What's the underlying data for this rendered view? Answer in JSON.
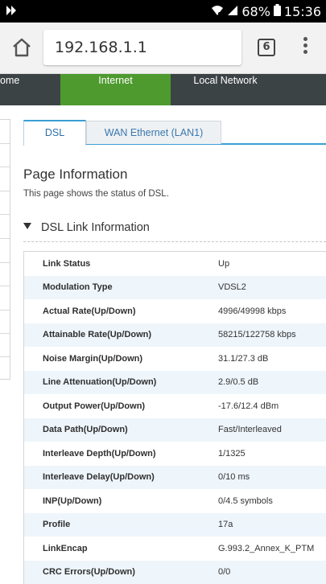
{
  "status_bar": {
    "battery": "68%",
    "time": "15:36"
  },
  "browser": {
    "url": "192.168.1.1",
    "tab_count": "6"
  },
  "nav": {
    "home": "ome",
    "internet": "Internet",
    "local_network": "Local Network"
  },
  "subtabs": {
    "dsl": "DSL",
    "wan": "WAN Ethernet (LAN1)"
  },
  "page": {
    "title": "Page Information",
    "description": "This page shows the status of DSL.",
    "section": "DSL Link Information"
  },
  "rows": [
    {
      "label": "Link Status",
      "value": "Up"
    },
    {
      "label": "Modulation Type",
      "value": "VDSL2"
    },
    {
      "label": "Actual Rate(Up/Down)",
      "value": "4996/49998 kbps"
    },
    {
      "label": "Attainable Rate(Up/Down)",
      "value": "58215/122758 kbps"
    },
    {
      "label": "Noise Margin(Up/Down)",
      "value": "31.1/27.3 dB"
    },
    {
      "label": "Line Attenuation(Up/Down)",
      "value": "2.9/0.5 dB"
    },
    {
      "label": "Output Power(Up/Down)",
      "value": "-17.6/12.4 dBm"
    },
    {
      "label": "Data Path(Up/Down)",
      "value": "Fast/Interleaved"
    },
    {
      "label": "Interleave Depth(Up/Down)",
      "value": "1/1325"
    },
    {
      "label": "Interleave Delay(Up/Down)",
      "value": "0/10 ms"
    },
    {
      "label": "INP(Up/Down)",
      "value": "0/4.5 symbols"
    },
    {
      "label": "Profile",
      "value": "17a"
    },
    {
      "label": "LinkEncap",
      "value": "G.993.2_Annex_K_PTM"
    },
    {
      "label": "CRC Errors(Up/Down)",
      "value": "0/0"
    }
  ],
  "colors": {
    "nav_bg": "#3c4345",
    "nav_active": "#4e9a2f",
    "tab_accent": "#3b9fd4",
    "row_stripe": "#eef5fb"
  }
}
